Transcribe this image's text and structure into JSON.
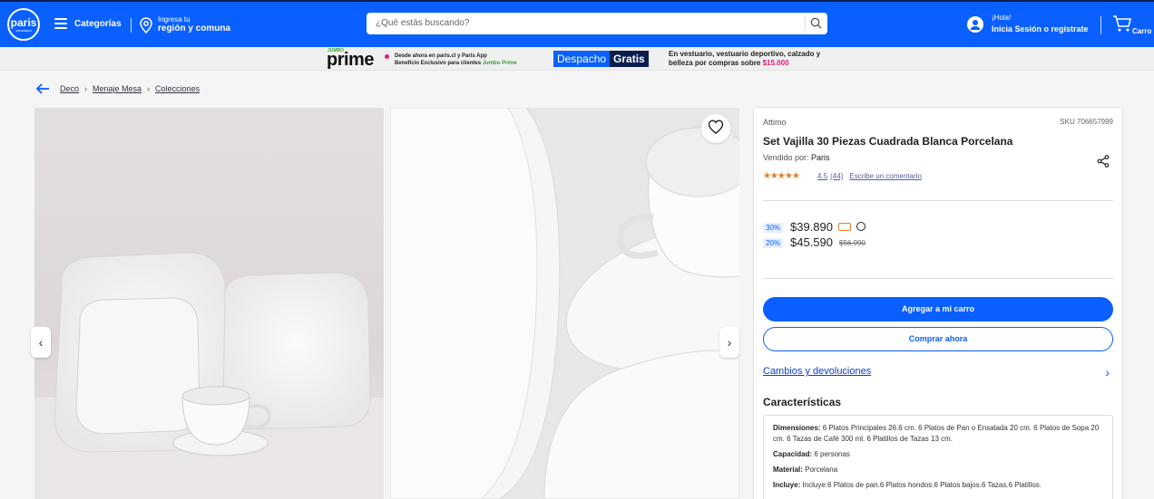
{
  "header": {
    "logo_text": "paris",
    "logo_sub": "cencosud",
    "categories": "Categorías",
    "region_line1": "Ingresa tu",
    "region_line2": "región y comuna",
    "search_placeholder": "¿Qué estás buscando?",
    "user_greeting": "¡Hola!",
    "user_login": "Inicia Sesión o regístrate",
    "cart_label": "Carro"
  },
  "promo": {
    "prime_top": "JUMBO",
    "prime_brand": "prime",
    "prime_line1": "Desde ahora en paris.cl y Paris App",
    "prime_line2_a": "Beneficio Exclusivo para clientes ",
    "prime_line2_b": "Jumbo Prime",
    "despacho_a": "Despacho",
    "despacho_b": "Gratis",
    "desp_line1": "En vestuario, vestuario deportivo, calzado y",
    "desp_line2_a": "belleza por compras sobre ",
    "desp_line2_b": "$15.000"
  },
  "breadcrumb": [
    "Deco",
    "Menaje Mesa",
    "Colecciones"
  ],
  "product": {
    "brand": "Attimo",
    "sku": "SKU 706657999",
    "title": "Set Vajilla 30 Piezas Cuadrada Blanca Porcelana",
    "seller_label": "Vendido por: ",
    "seller": "Paris",
    "stars": "★★★★★",
    "rating": "4.5",
    "reviews": "(44)",
    "write_review": "Escribe un comentario",
    "discount1": "30%",
    "price1": "$39.890",
    "discount2": "20%",
    "price2": "$45.590",
    "old_price": "$56.990",
    "add_to_cart": "Agregar a mi carro",
    "buy_now": "Comprar ahora",
    "returns": "Cambios y devoluciones",
    "characteristics": "Características"
  },
  "specs": [
    {
      "label": "Dimensiones:",
      "value": " 6 Platos Principales 26.6 cm. 6 Platos de Pan o Ensalada 20 cm. 6 Platos de Sopa 20 cm. 6 Tazas de Café 300 ml. 6 Platillos de Tazas 13 cm."
    },
    {
      "label": "Capacidad:",
      "value": " 6 personas"
    },
    {
      "label": "Material:",
      "value": " Porcelana"
    },
    {
      "label": "Incluye:",
      "value": " Incluye:6 Platos de pan.6 Platos hondos.6 Platos bajos.6 Tazas.6 Platillos."
    }
  ],
  "colors": {
    "primary": "#0a5fff",
    "pink": "#e0197d",
    "green": "#3a9f3a",
    "star": "#e57b2a"
  }
}
